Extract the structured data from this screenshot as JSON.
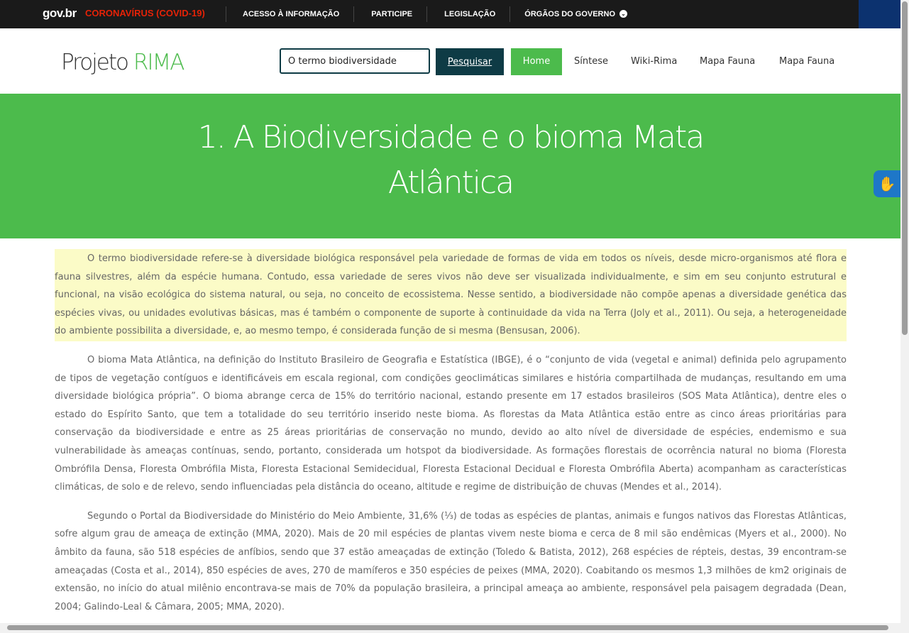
{
  "govbar": {
    "logo": "gov.br",
    "covid": "CORONAVÍRUS (COVID-19)",
    "links": [
      "ACESSO À INFORMAÇÃO",
      "PARTICIPE",
      "LEGISLAÇÃO",
      "ÓRGÃOS DO GOVERNO"
    ]
  },
  "header": {
    "brand_main": "Projeto ",
    "brand_accent": "RIMA",
    "search_value": "O termo biodiversidade",
    "search_button": "Pesquisar",
    "nav": [
      "Home",
      "Síntese",
      "Wiki-Rima",
      "Mapa Fauna",
      "Mapa Fauna"
    ]
  },
  "hero": {
    "title": "1. A Biodiversidade e o bioma Mata Atlântica"
  },
  "content": {
    "paragraphs": [
      "O termo biodiversidade refere-se à diversidade biológica responsável pela variedade de formas de vida em todos os níveis, desde micro-organismos até flora e fauna silvestres, além da espécie humana. Contudo, essa variedade de seres vivos não deve ser visualizada individualmente, e sim em seu conjunto estrutural e funcional, na visão ecológica do sistema natural, ou seja, no conceito de ecossistema. Nesse sentido, a biodiversidade não compõe apenas a diversidade genética das espécies vivas, ou unidades evolutivas básicas, mas é também o componente de suporte à continuidade da vida na Terra (Joly et al., 2011). Ou seja, a heterogeneidade do ambiente possibilita a diversidade, e, ao mesmo tempo, é considerada função de si mesma (Bensusan, 2006).",
      "O bioma Mata Atlântica, na definição do Instituto Brasileiro de Geografia e Estatística (IBGE), é o “conjunto de vida (vegetal e animal) definida pelo agrupamento de tipos de vegetação contíguos e identificáveis em escala regional, com condições geoclimáticas similares e história compartilhada de mudanças, resultando em uma diversidade biológica própria”. O bioma abrange cerca de 15% do território nacional, estando presente em 17 estados brasileiros (SOS Mata Atlântica), dentre eles o estado do Espírito Santo, que tem a totalidade do seu território inserido neste bioma. As florestas da Mata Atlântica estão entre as cinco áreas prioritárias para conservação da biodiversidade e entre as 25 áreas prioritárias de conservação no mundo, devido ao alto nível de diversidade de espécies, endemismo e sua vulnerabilidade às ameaças contínuas, sendo, portanto, considerada um hotspot da biodiversidade. As formações florestais de ocorrência natural no bioma (Floresta Ombrófila Densa, Floresta Ombrófila Mista, Floresta Estacional Semidecidual, Floresta Estacional Decidual e Floresta Ombrófila Aberta) acompanham as características climáticas, de solo e de relevo, sendo influenciadas pela distância do oceano, altitude e regime de distribuição de chuvas (Mendes et al., 2014).",
      "Segundo o Portal da Biodiversidade do Ministério do Meio Ambiente, 31,6% (⅓) de todas as espécies de plantas, animais e fungos nativos das Florestas Atlânticas, sofre algum grau de ameaça de extinção (MMA, 2020). Mais de 20 mil espécies de plantas vivem neste bioma e cerca de 8 mil são endêmicas (Myers et al., 2000). No âmbito da fauna, são 518 espécies de anfíbios, sendo que 37 estão ameaçadas de extinção (Toledo & Batista, 2012), 268 espécies de répteis, destas, 39 encontram-se ameaçadas (Costa et al., 2014), 850 espécies de aves, 270 de mamíferos e 350 espécies de peixes (MMA, 2020). Coabitando os mesmos 1,3 milhões de km2 originais de extensão, no início do atual milênio encontrava-se mais de 70% da população brasileira, a principal ameaça ao ambiente, responsável pela paisagem degradada (Dean, 2004; Galindo-Leal & Câmara, 2005; MMA, 2020)."
    ]
  },
  "colors": {
    "brand_green": "#4cbb4c",
    "dark_teal": "#0e3b45",
    "highlight": "#fbfbc7",
    "covid_red": "#e52207"
  },
  "icons": [
    "chevron-down-icon",
    "sign-language-icon"
  ]
}
